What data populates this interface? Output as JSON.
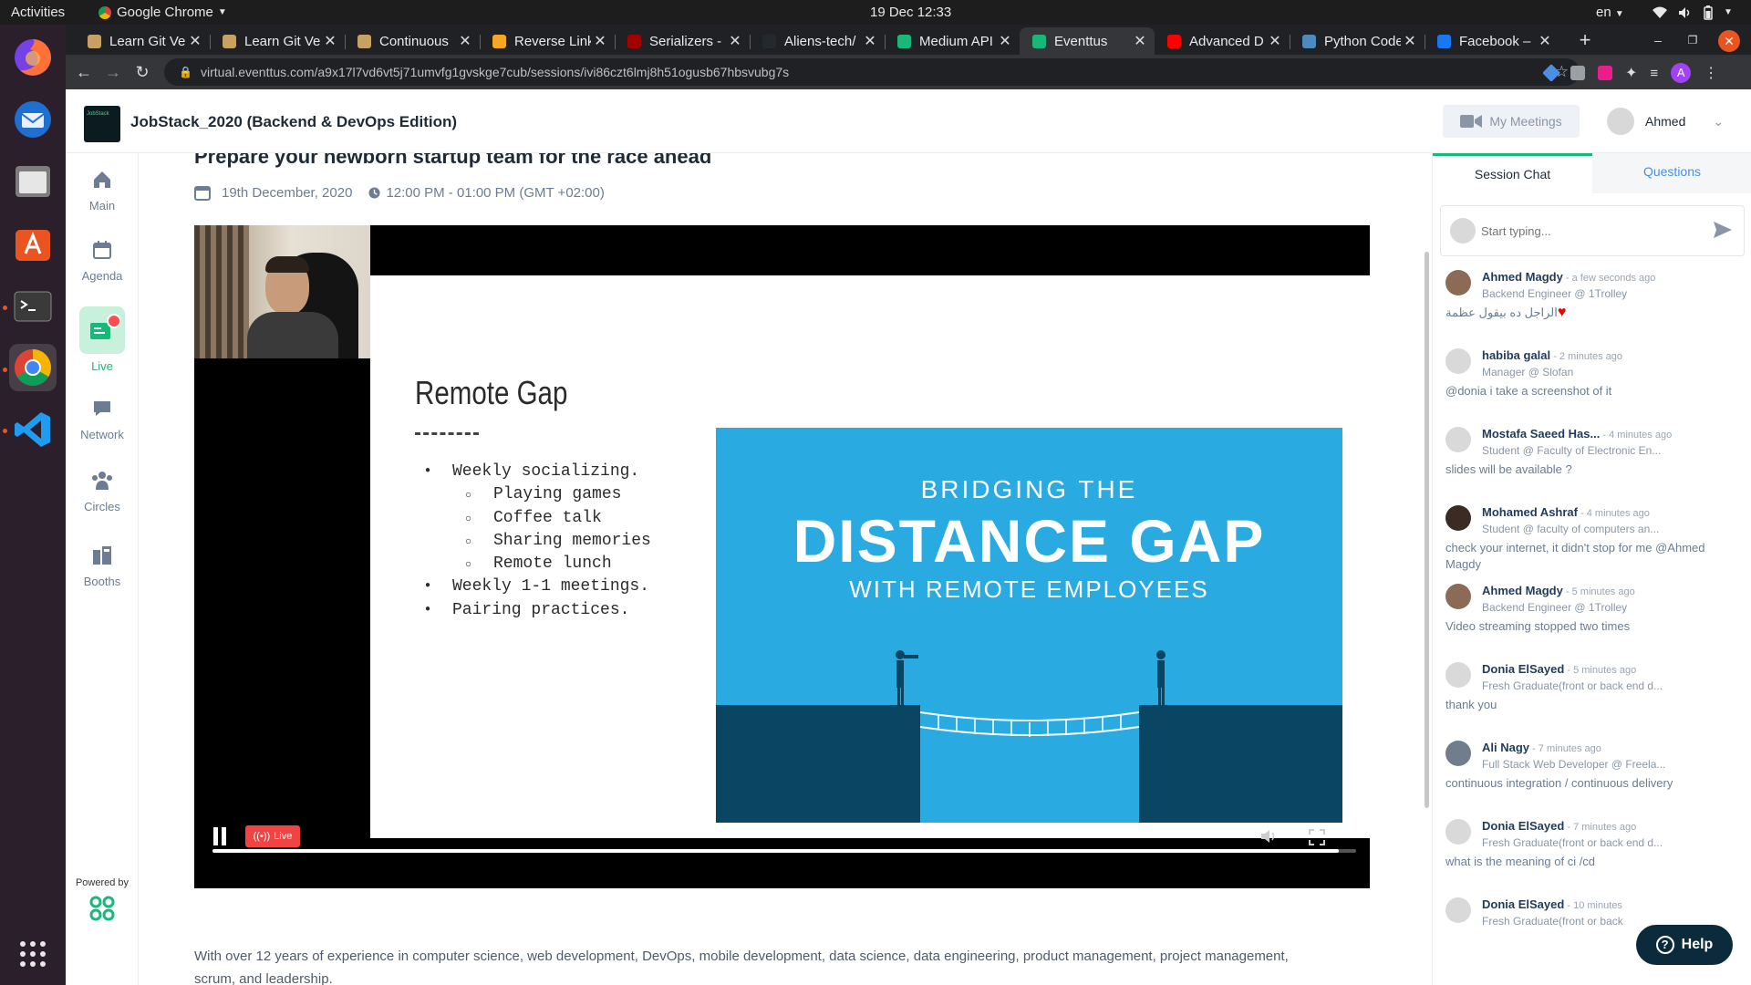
{
  "system_bar": {
    "activities": "Activities",
    "app_name": "Google Chrome",
    "datetime": "19 Dec  12:33",
    "language": "en"
  },
  "dock": {
    "apps": [
      "firefox-icon",
      "thunderbird-icon",
      "files-icon",
      "software-icon",
      "terminal-icon",
      "chrome-icon",
      "vscode-icon"
    ]
  },
  "browser": {
    "tabs": [
      {
        "title": "Learn Git Ve",
        "color": "#c8a165"
      },
      {
        "title": "Learn Git Ve",
        "color": "#c8a165"
      },
      {
        "title": "Continuous",
        "color": "#c8a165"
      },
      {
        "title": "Reverse Link",
        "color": "#f5a623"
      },
      {
        "title": "Serializers -",
        "color": "#a30000"
      },
      {
        "title": "Aliens-tech/",
        "color": "#24292e"
      },
      {
        "title": "Medium API",
        "color": "#1ab77a"
      },
      {
        "title": "Eventtus",
        "color": "#1ab77a",
        "active": true
      },
      {
        "title": "Advanced D",
        "color": "#ff0000"
      },
      {
        "title": "Python Code",
        "color": "#4b8bbe"
      },
      {
        "title": "Facebook –",
        "color": "#1877f2"
      }
    ],
    "new_tab": "+",
    "url": "virtual.eventtus.com/a9x17l7vd6vt5j71umvfg1gvskge7cub/sessions/ivi86czt6lmj8h51ogusb67hbsvubg7s",
    "profile_initial": "A"
  },
  "app": {
    "event_title": "JobStack_2020 (Backend & DevOps Edition)",
    "logo_text": "JobStack",
    "my_meetings": "My Meetings",
    "user_name": "Ahmed",
    "nav": [
      {
        "label": "Main",
        "icon": "home-icon"
      },
      {
        "label": "Agenda",
        "icon": "calendar-icon"
      },
      {
        "label": "Live",
        "icon": "live-icon",
        "active": true
      },
      {
        "label": "Network",
        "icon": "chat-icon"
      },
      {
        "label": "Circles",
        "icon": "group-icon"
      },
      {
        "label": "Booths",
        "icon": "booth-icon"
      }
    ],
    "powered_by": "Powered by",
    "session": {
      "title": "Prepare your newborn startup team for the race ahead",
      "date": "19th December, 2020",
      "time": "12:00 PM - 01:00 PM (GMT +02:00)",
      "description": "With over 12 years of experience in computer science, web development, DevOps, mobile development, data science, data engineering, product management, project management, scrum, and leadership."
    },
    "slide": {
      "heading": "Remote Gap",
      "bullets": [
        {
          "text": "Weekly socializing.",
          "level": 1
        },
        {
          "text": "Playing games",
          "level": 2
        },
        {
          "text": "Coffee talk",
          "level": 2
        },
        {
          "text": "Sharing memories",
          "level": 2
        },
        {
          "text": "Remote lunch",
          "level": 2
        },
        {
          "text": "Weekly 1-1 meetings.",
          "level": 1
        },
        {
          "text": "Pairing practices.",
          "level": 1
        }
      ],
      "image_line1": "BRIDGING THE",
      "image_line2": "DISTANCE GAP",
      "image_line3": "WITH REMOTE EMPLOYEES",
      "image_bg": "#29abe2",
      "image_dark": "#0a4563"
    },
    "player": {
      "live_label": "Live",
      "progress": 1.0
    },
    "chat": {
      "tabs": [
        "Session Chat",
        "Questions"
      ],
      "placeholder": "Start typing...",
      "messages": [
        {
          "name": "Ahmed Magdy",
          "time": " - a few seconds ago",
          "role": "Backend Engineer @ 1Trolley",
          "text": "الراجل ده بيقول عظمة"
        },
        {
          "name": "habiba galal",
          "time": " - 2 minutes ago",
          "role": "Manager @ Slofan",
          "text": "@donia i take a screenshot of it"
        },
        {
          "name": "Mostafa Saeed Has...",
          "time": " - 4 minutes ago",
          "role": "Student @ Faculty of Electronic En...",
          "text": "slides will be available ?"
        },
        {
          "name": "Mohamed Ashraf",
          "time": " - 4 minutes ago",
          "role": "Student @ faculty of computers an...",
          "text": "check your internet, it didn't stop for me @Ahmed Magdy"
        },
        {
          "name": "Ahmed Magdy",
          "time": " - 5 minutes ago",
          "role": "Backend Engineer @ 1Trolley",
          "text": "Video streaming stopped two times"
        },
        {
          "name": "Donia ElSayed",
          "time": " - 5 minutes ago",
          "role": "Fresh Graduate(front or back end d...",
          "text": "thank you"
        },
        {
          "name": "Ali Nagy",
          "time": " - 7 minutes ago",
          "role": "Full Stack Web Developer @ Freela...",
          "text": "continuous integration / continuous delivery"
        },
        {
          "name": "Donia ElSayed",
          "time": " - 7 minutes ago",
          "role": "Fresh Graduate(front or back end d...",
          "text": "what is the meaning of ci /cd"
        },
        {
          "name": "Donia ElSayed",
          "time": " - 10 minutes",
          "role": "Fresh Graduate(front or back",
          "text": ""
        }
      ]
    },
    "help_label": "Help"
  }
}
